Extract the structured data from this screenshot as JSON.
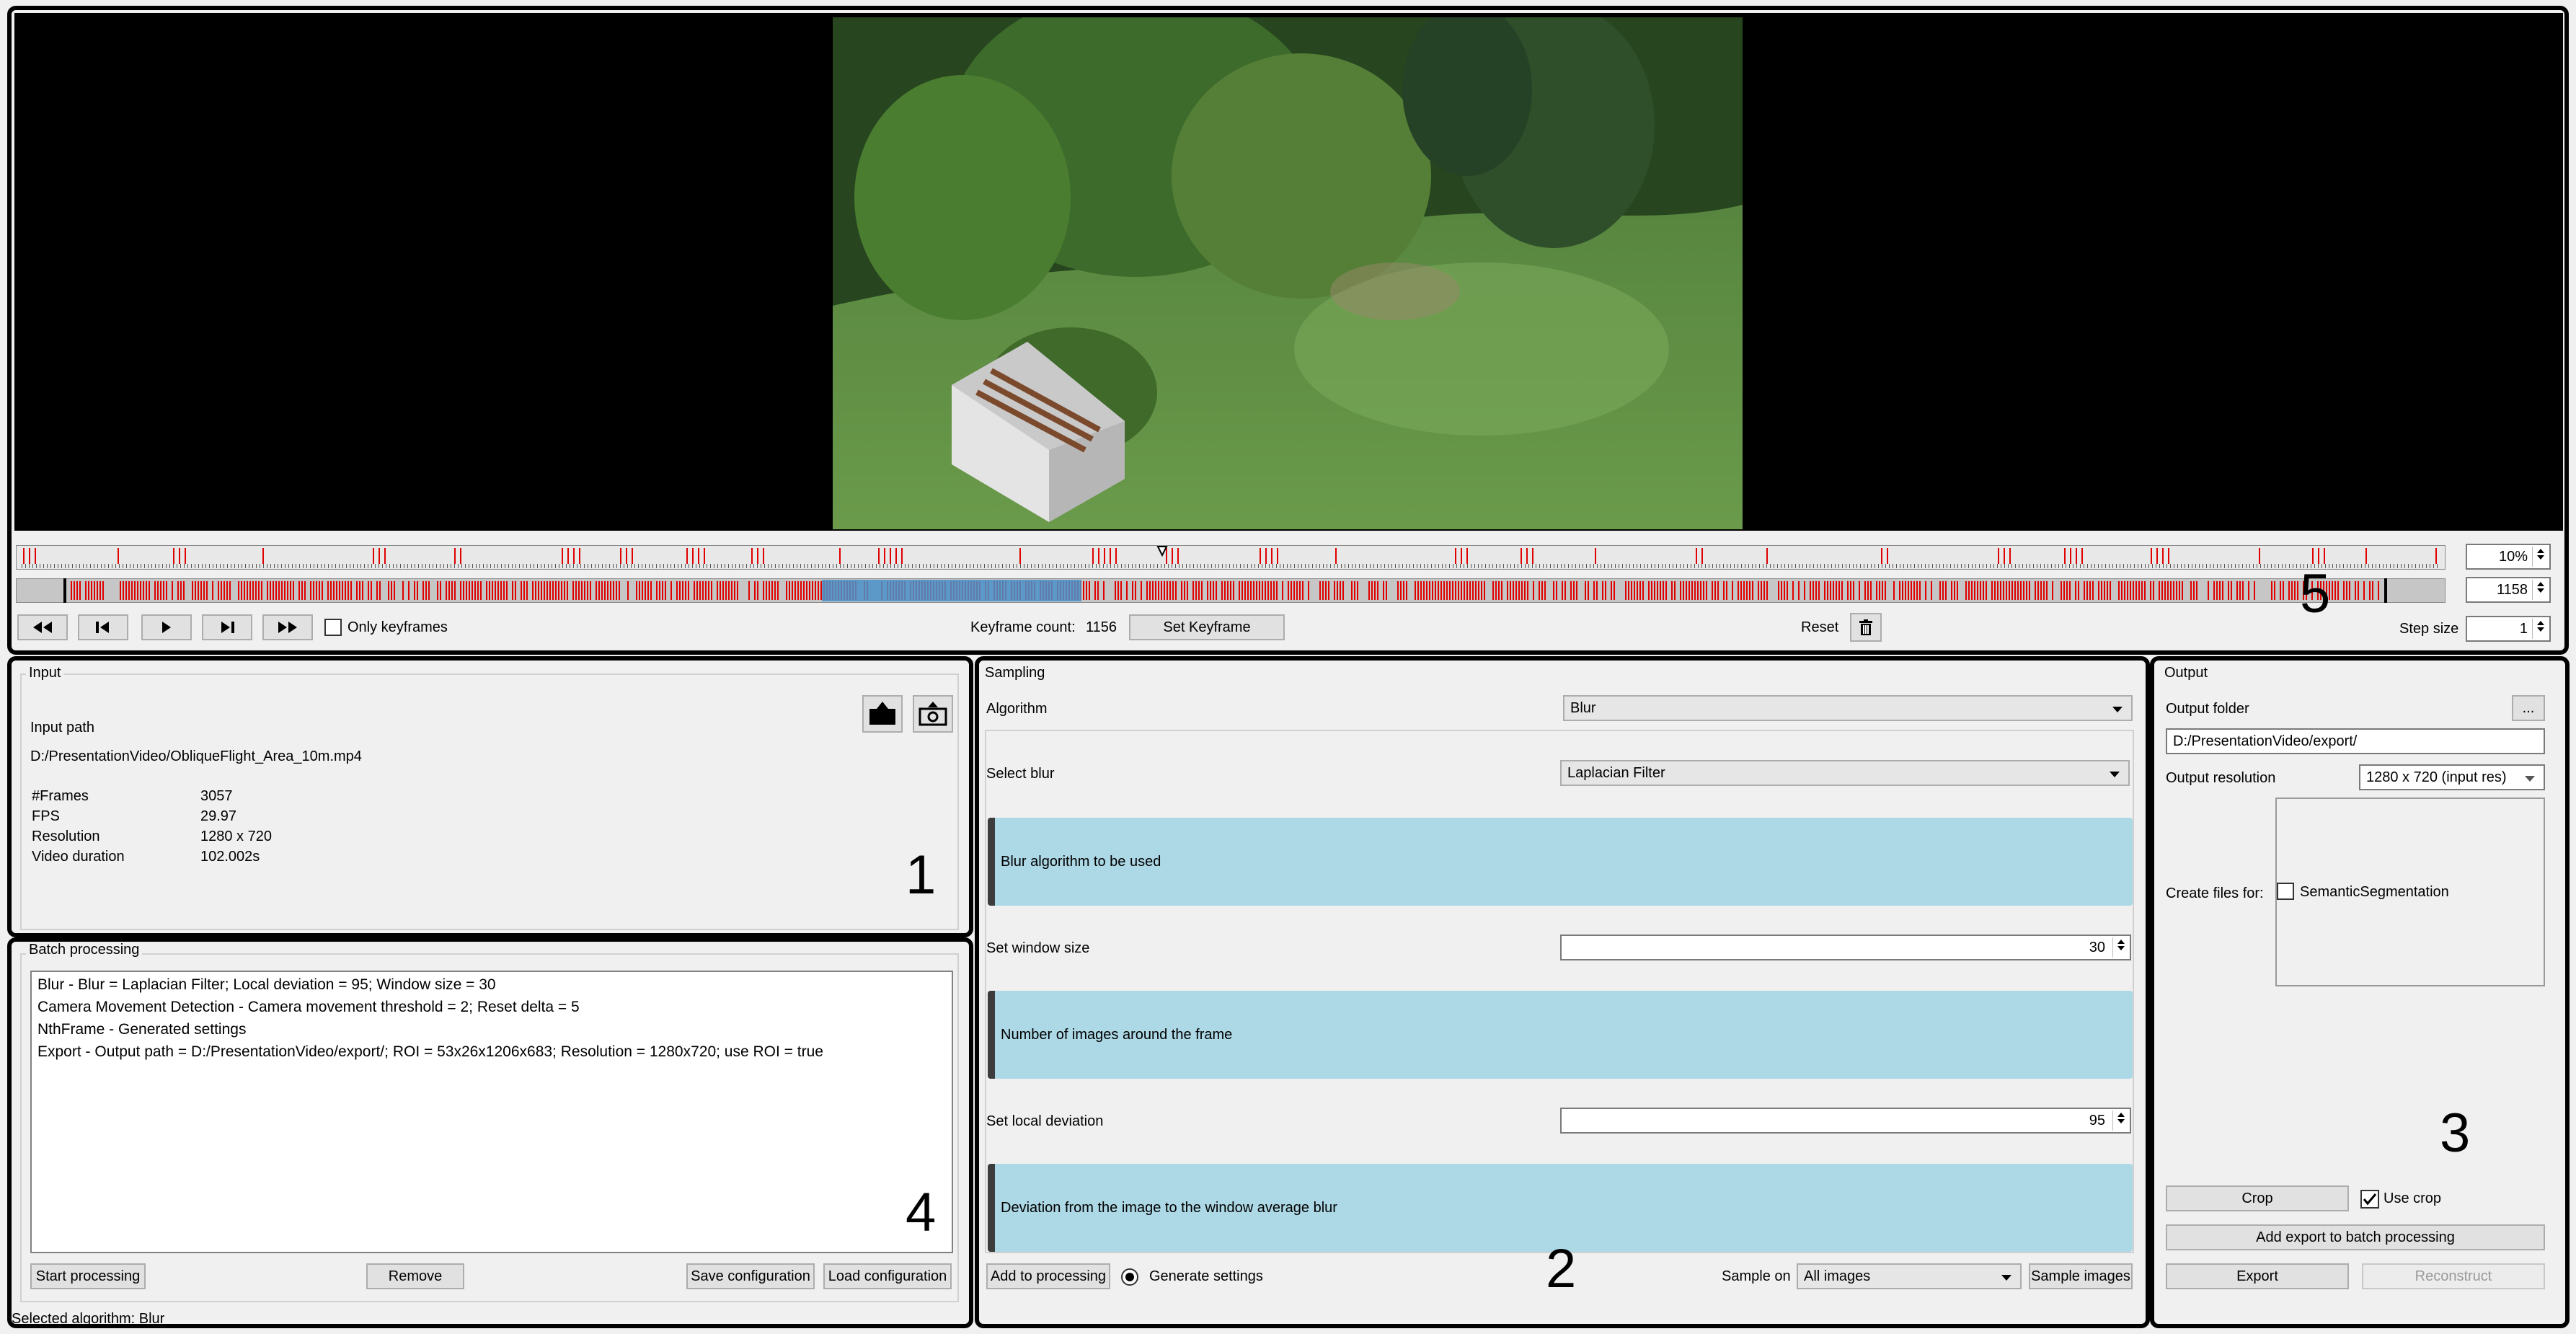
{
  "player": {
    "controls": {
      "only_keyframes_label": "Only keyframes",
      "keyframe_count_label": "Keyframe count:",
      "keyframe_count_value": "1156",
      "set_keyframe_label": "Set Keyframe",
      "reset_label": "Reset",
      "step_size_label": "Step size"
    },
    "zoom_value": "10%",
    "range_value": "1158",
    "step_size_value": "1"
  },
  "input": {
    "title": "Input",
    "path_label": "Input path",
    "path_value": "D:/PresentationVideo/ObliqueFlight_Area_10m.mp4",
    "props": [
      {
        "key": "#Frames",
        "value": "3057"
      },
      {
        "key": "FPS",
        "value": "29.97"
      },
      {
        "key": "Resolution",
        "value": "1280 x 720"
      },
      {
        "key": "Video duration",
        "value": "102.002s"
      }
    ]
  },
  "batch": {
    "title": "Batch processing",
    "items": [
      "Blur - Blur = Laplacian Filter; Local deviation = 95; Window size = 30",
      "Camera Movement Detection - Camera movement threshold = 2; Reset delta = 5",
      "NthFrame  -  Generated settings",
      "Export - Output path = D:/PresentationVideo/export/; ROI = 53x26x1206x683; Resolution = 1280x720; use ROI = true"
    ],
    "start_label": "Start processing",
    "remove_label": "Remove",
    "save_label": "Save configuration",
    "load_label": "Load configuration"
  },
  "sampling": {
    "title": "Sampling",
    "algorithm_label": "Algorithm",
    "algorithm_value": "Blur",
    "select_blur_label": "Select blur",
    "select_blur_value": "Laplacian Filter",
    "info_blur": "Blur algorithm to be used",
    "window_label": "Set window size",
    "window_value": "30",
    "info_window": "Number of images around the frame",
    "deviation_label": "Set local deviation",
    "deviation_value": "95",
    "info_deviation": "Deviation from the image to the window average blur",
    "add_label": "Add to processing",
    "generate_label": "Generate settings",
    "sample_on_label": "Sample on",
    "sample_on_value": "All images",
    "sample_images_label": "Sample images"
  },
  "output": {
    "title": "Output",
    "folder_label": "Output folder",
    "browse_label": "...",
    "folder_value": "D:/PresentationVideo/export/",
    "resolution_label": "Output resolution",
    "resolution_value": "1280 x 720 (input res)",
    "create_files_label": "Create files for:",
    "semantic_label": "SemanticSegmentation",
    "crop_label": "Crop",
    "use_crop_label": "Use crop",
    "add_export_label": "Add export to batch processing",
    "export_label": "Export",
    "reconstruct_label": "Reconstruct"
  },
  "status": {
    "text": "Selected algorithm: Blur"
  },
  "annotations": {
    "n1": "1",
    "n2": "2",
    "n3": "3",
    "n4": "4",
    "n5": "5"
  },
  "colors": {
    "keyframe_marker": "#e00000",
    "selection": "#4a90c8",
    "info_box": "#add8e6",
    "panel": "#f0f0f0"
  }
}
